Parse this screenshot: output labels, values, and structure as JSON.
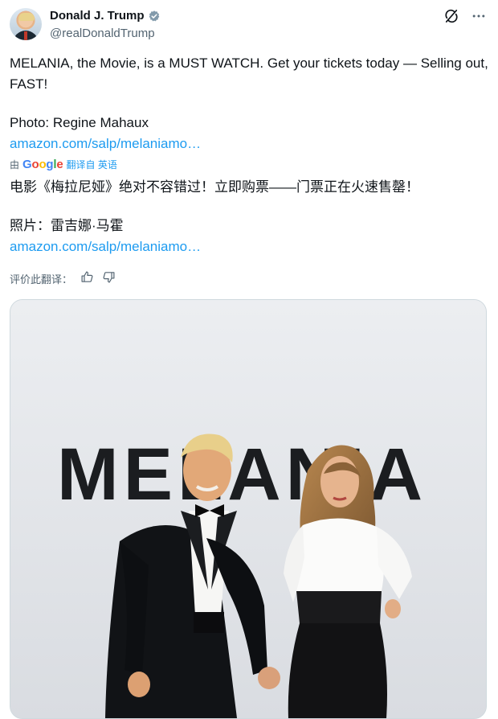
{
  "author": {
    "display_name": "Donald J. Trump",
    "handle": "@realDonaldTrump",
    "verified": true
  },
  "icons": {
    "grok": "grok-icon",
    "more": "more-icon",
    "verified": "verified-badge-icon",
    "like": "thumbs-up-icon",
    "dislike": "thumbs-down-icon"
  },
  "post": {
    "text_line": "MELANIA, the Movie, is a MUST WATCH. Get your tickets today — Selling out, FAST!",
    "photo_credit": "Photo: Regine Mahaux",
    "link": "amazon.com/salp/melaniamo…"
  },
  "translation": {
    "by": "由",
    "provider_letters": [
      "G",
      "o",
      "o",
      "g",
      "l",
      "e"
    ],
    "translated_from": "翻译自 英语",
    "text_line": "电影《梅拉尼娅》绝对不容错过！立即购票——门票正在火速售罄！",
    "photo_credit": "照片：雷吉娜·马霍",
    "link": "amazon.com/salp/melaniamo…",
    "rate_label": "评价此翻译："
  },
  "photo": {
    "backdrop_text": "MELANIA"
  },
  "colors": {
    "link": "#1d9bf0",
    "secondary_text": "#536471",
    "verified": "#829aab"
  }
}
